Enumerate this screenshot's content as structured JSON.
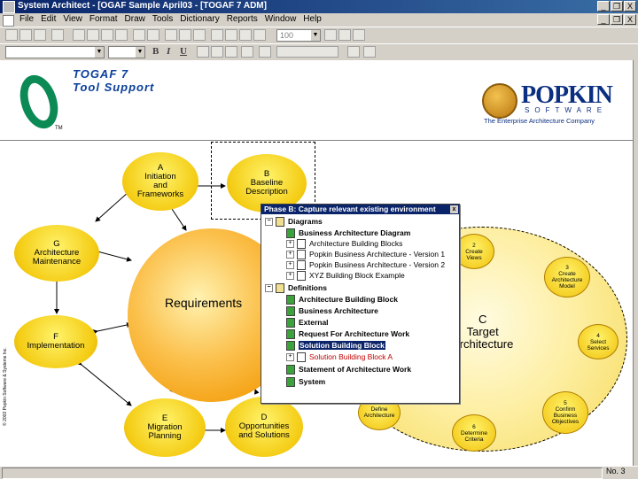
{
  "window": {
    "title": "System Architect - [OGAF Sample April03 - [TOGAF 7 ADM]",
    "controls": [
      "_",
      "❒",
      "X"
    ]
  },
  "menu": {
    "items": [
      "File",
      "Edit",
      "View",
      "Format",
      "Draw",
      "Tools",
      "Dictionary",
      "Reports",
      "Window",
      "Help"
    ],
    "controls": [
      "_",
      "❒",
      "X"
    ]
  },
  "toolbar": {
    "zoom_value": "100",
    "font_combo": "",
    "size_combo": "",
    "bold": "B",
    "italic": "I",
    "underline": "U"
  },
  "header": {
    "togaf_title": "TOGAF 7",
    "togaf_subtitle": "Tool Support",
    "tm": "TM",
    "popkin_name": "POPKIN",
    "popkin_software": "SOFTWARE",
    "popkin_tagline": "The Enterprise Architecture Company",
    "copyright": "© 2003 Popkin Software & Systems Inc."
  },
  "diagram": {
    "nodes": {
      "a": "A\nInitiation\nand\nFrameworks",
      "b": "B\nBaseline\nDescription",
      "g": "G\nArchitecture\nMaintenance",
      "f": "F\nImplementation",
      "e": "E\nMigration\nPlanning",
      "d": "D\nOpportunities\nand Solutions"
    },
    "requirements": "Requirements",
    "c_label": "C\nTarget\nArchitecture",
    "c_steps": {
      "s2": "2\nCreate\nViews",
      "s3": "3\nCreate\nArchitecture\nModel",
      "s4": "4\nSelect\nServices",
      "s5": "5\nConfirm\nBusiness\nObjectives",
      "s6": "6\nDetermine\nCriteria",
      "s7": "Define\nArchitecture"
    }
  },
  "popup": {
    "title": "Phase B: Capture relevant existing environment",
    "close": "x",
    "tree": [
      {
        "label": "Diagrams",
        "expander": "−",
        "icon": "folder",
        "bold": true
      },
      {
        "label": "Business Architecture Diagram",
        "expander": "",
        "icon": "green",
        "bold": true
      },
      {
        "label": "Architecture Building Blocks",
        "expander": "+",
        "icon": "doc",
        "bold": false
      },
      {
        "label": "Popkin Business Architecture - Version 1",
        "expander": "+",
        "icon": "doc",
        "bold": false
      },
      {
        "label": "Popkin Business Architecture - Version 2",
        "expander": "+",
        "icon": "doc",
        "bold": false
      },
      {
        "label": "XYZ Building Block Example",
        "expander": "+",
        "icon": "doc",
        "bold": false
      },
      {
        "label": "Definitions",
        "expander": "−",
        "icon": "folder",
        "bold": true
      },
      {
        "label": "Architecture Building Block",
        "expander": "",
        "icon": "green",
        "bold": true
      },
      {
        "label": "Business Architecture",
        "expander": "",
        "icon": "green",
        "bold": true
      },
      {
        "label": "External",
        "expander": "",
        "icon": "green",
        "bold": true
      },
      {
        "label": "Request For Architecture Work",
        "expander": "",
        "icon": "green",
        "bold": true
      },
      {
        "label": "Solution Building Block",
        "expander": "",
        "icon": "green",
        "bold": true,
        "selected": true
      },
      {
        "label": "Solution Building Block A",
        "expander": "+",
        "icon": "doc",
        "bold": false,
        "red": true
      },
      {
        "label": "Statement of Architecture Work",
        "expander": "",
        "icon": "green",
        "bold": true
      },
      {
        "label": "System",
        "expander": "",
        "icon": "green",
        "bold": true
      }
    ]
  },
  "status": {
    "page": "No. 3"
  },
  "colors": {
    "titlebar": "#0a246a",
    "chrome": "#d4d0c8",
    "togaf_green": "#0b8a55",
    "popkin_blue": "#0b2f80",
    "node_yellow": "#f4cc14",
    "requirements_orange": "#f4a010"
  }
}
